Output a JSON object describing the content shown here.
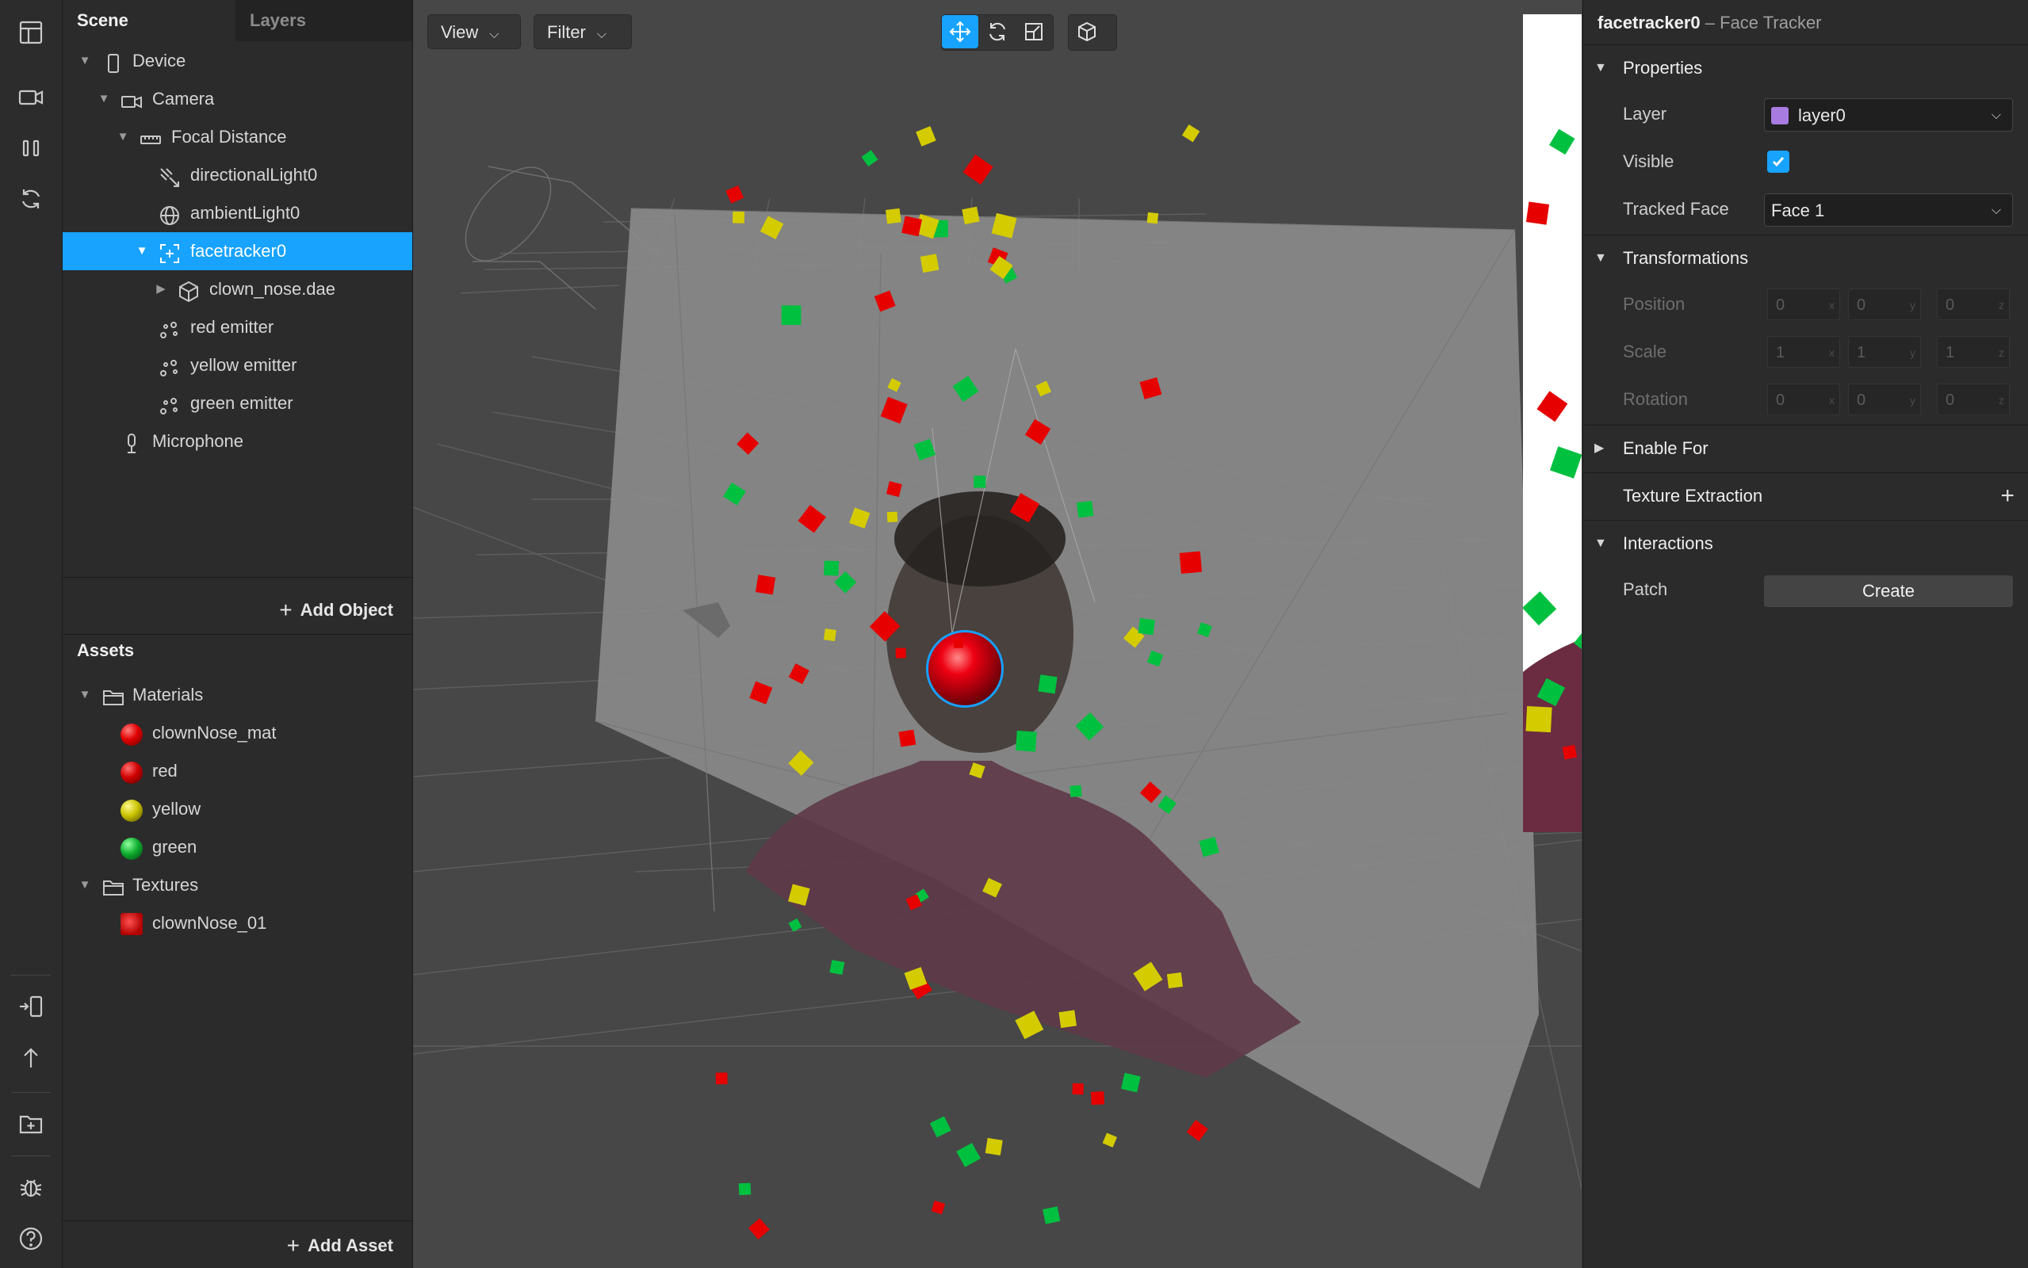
{
  "scene_panel": {
    "tabs": [
      {
        "label": "Scene",
        "active": true
      },
      {
        "label": "Layers",
        "active": false
      }
    ],
    "tree": [
      {
        "label": "Device",
        "icon": "device-icon",
        "expanded": true
      },
      {
        "label": "Camera",
        "icon": "camera-icon",
        "expanded": true
      },
      {
        "label": "Focal Distance",
        "icon": "ruler-icon",
        "expanded": true
      },
      {
        "label": "directionalLight0",
        "icon": "directional-light-icon"
      },
      {
        "label": "ambientLight0",
        "icon": "ambient-light-icon"
      },
      {
        "label": "facetracker0",
        "icon": "face-tracker-icon",
        "expanded": true,
        "selected": true
      },
      {
        "label": "clown_nose.dae",
        "icon": "3d-object-icon",
        "expanded": false
      },
      {
        "label": "red emitter",
        "icon": "emitter-icon"
      },
      {
        "label": "yellow emitter",
        "icon": "emitter-icon"
      },
      {
        "label": "green emitter",
        "icon": "emitter-icon"
      },
      {
        "label": "Microphone",
        "icon": "microphone-icon"
      }
    ],
    "add_object_label": "Add Object"
  },
  "assets_panel": {
    "title": "Assets",
    "tree": [
      {
        "label": "Materials",
        "icon": "folder-icon",
        "expanded": true
      },
      {
        "label": "clownNose_mat",
        "color": "#e00000"
      },
      {
        "label": "red",
        "color": "#d00000"
      },
      {
        "label": "yellow",
        "color": "#c9c200"
      },
      {
        "label": "green",
        "color": "#10b030"
      },
      {
        "label": "Textures",
        "icon": "folder-icon",
        "expanded": true
      },
      {
        "label": "clownNose_01",
        "icon": "texture-icon"
      }
    ],
    "add_asset_label": "Add Asset"
  },
  "viewport": {
    "view_label": "View",
    "filter_label": "Filter",
    "tools": [
      "move-icon",
      "rotate-icon",
      "scale-icon",
      "cube-icon"
    ],
    "active_tool": "move-icon"
  },
  "inspector": {
    "object_name": "facetracker0",
    "object_type": " – Face Tracker",
    "sections": {
      "properties": "Properties",
      "transformations": "Transformations",
      "enable_for": "Enable For",
      "texture_extraction": "Texture Extraction",
      "interactions": "Interactions"
    },
    "layer": {
      "label": "Layer",
      "value": "layer0",
      "swatch_color": "#a87be0"
    },
    "visible": {
      "label": "Visible",
      "checked": true
    },
    "tracked_face": {
      "label": "Tracked Face",
      "value": "Face 1"
    },
    "position": {
      "label": "Position",
      "x": "0",
      "y": "0",
      "z": "0"
    },
    "scale": {
      "label": "Scale",
      "x": "1",
      "y": "1",
      "z": "1"
    },
    "rotation": {
      "label": "Rotation",
      "x": "0",
      "y": "0",
      "z": "0"
    },
    "axes": {
      "x": "x",
      "y": "y",
      "z": "z"
    },
    "patch": {
      "label": "Patch",
      "button": "Create"
    }
  },
  "colors": {
    "accent": "#17a3ff",
    "confetti_red": "#e60000",
    "confetti_yellow": "#d4cc00",
    "confetti_green": "#00c040",
    "nose_red": "#ee0011"
  }
}
